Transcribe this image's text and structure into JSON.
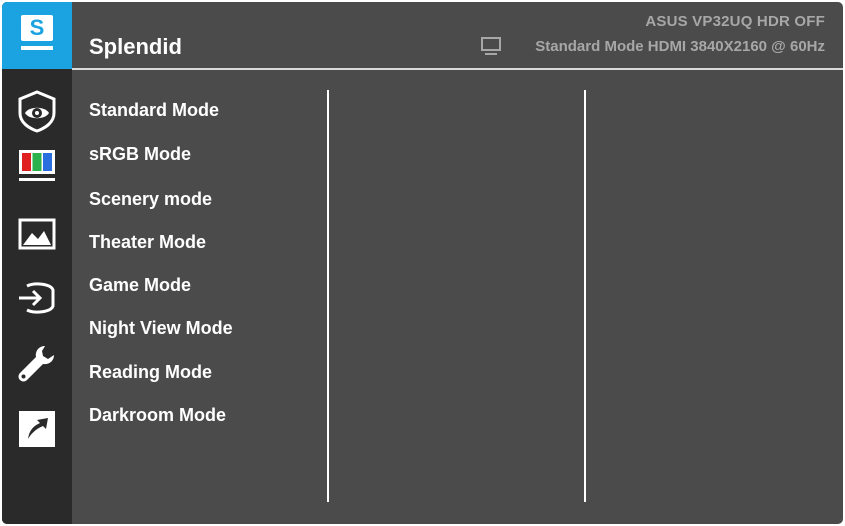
{
  "header": {
    "title": "Splendid",
    "model": "ASUS  VP32UQ  HDR OFF",
    "status": "Standard Mode HDMI 3840X2160 @ 60Hz",
    "status_icon": "monitor-icon"
  },
  "sidebar": {
    "logo_letter": "S",
    "items": [
      {
        "icon": "eye-care-icon"
      },
      {
        "icon": "color-bars-icon"
      },
      {
        "icon": "image-icon"
      },
      {
        "icon": "input-select-icon"
      },
      {
        "icon": "wrench-icon"
      },
      {
        "icon": "shortcut-icon"
      }
    ]
  },
  "menu": {
    "items": [
      "Standard Mode",
      "sRGB Mode",
      "Scenery mode",
      "Theater Mode",
      "Game Mode",
      "Night View Mode",
      "Reading Mode",
      "Darkroom Mode"
    ]
  },
  "colors": {
    "accent": "#1aa3e0",
    "panel": "#4b4b4b",
    "sidebar": "#2a2a2a",
    "text": "#ffffff",
    "muted_text": "#a7a7a7"
  }
}
